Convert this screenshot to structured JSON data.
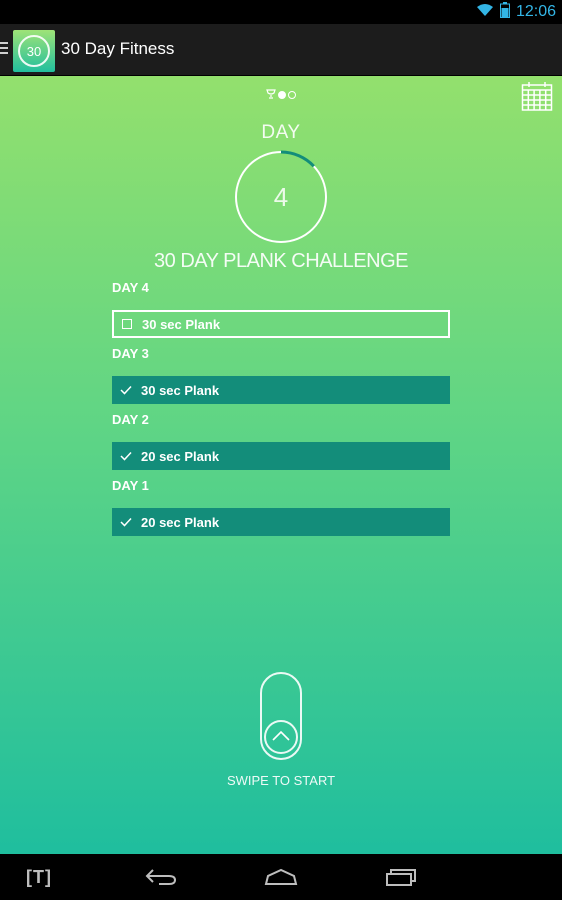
{
  "status_bar": {
    "time": "12:06"
  },
  "app": {
    "title": "30 Day Fitness",
    "logo_text": "30"
  },
  "hero": {
    "day_label": "DAY",
    "day_number": "4",
    "progress": 0.13,
    "challenge_title": "30 DAY PLANK CHALLENGE"
  },
  "days": [
    {
      "heading": "DAY 4",
      "task": "30 sec Plank",
      "done": false
    },
    {
      "heading": "DAY 3",
      "task": "30 sec Plank",
      "done": true
    },
    {
      "heading": "DAY 2",
      "task": "20 sec Plank",
      "done": true
    },
    {
      "heading": "DAY 1",
      "task": "20 sec Plank",
      "done": true
    }
  ],
  "swipe": {
    "label": "SWIPE TO START"
  },
  "nav": {
    "t_button": "[T]"
  },
  "colors": {
    "accent_ring": "#138d7a",
    "task_done_bg": "#138d7a",
    "status_time": "#33b5e5"
  }
}
